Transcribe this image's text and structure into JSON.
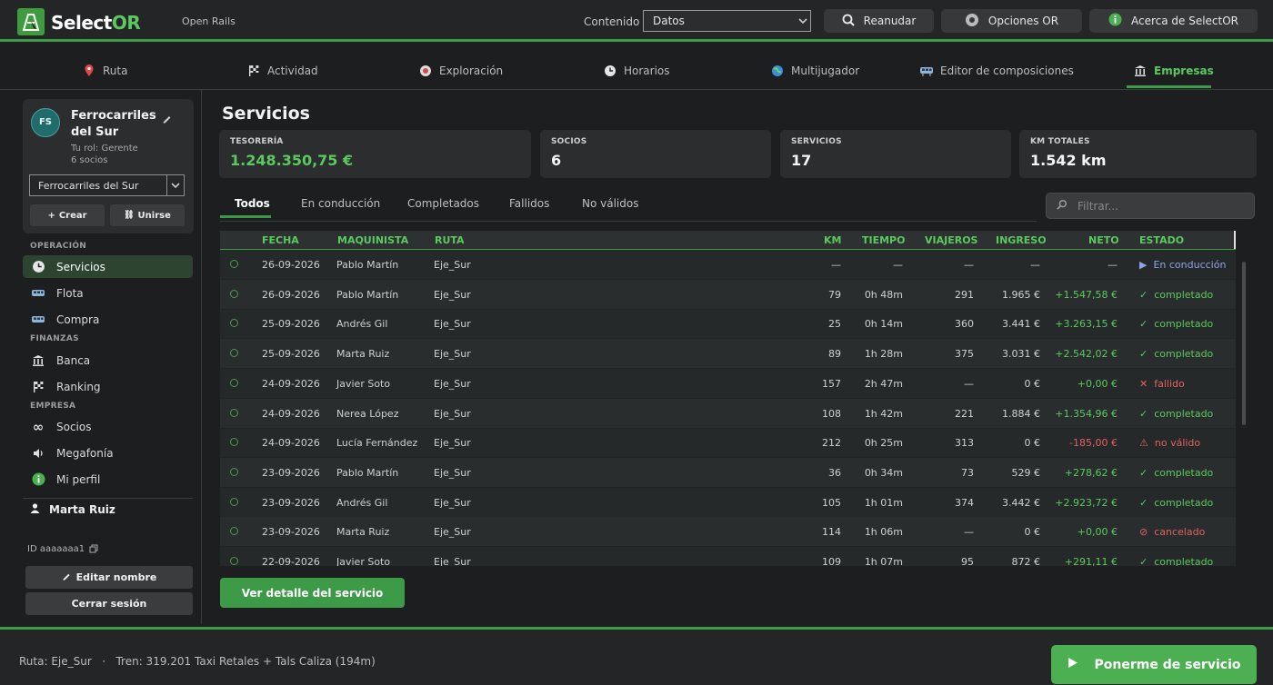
{
  "app": {
    "name_a": "Select",
    "name_b": "OR",
    "subtitle": "Open Rails"
  },
  "topbar": {
    "content_label": "Contenido",
    "content_value": "Datos",
    "resume": "Reanudar",
    "options": "Opciones OR",
    "about": "Acerca de SelectOR"
  },
  "nav": [
    "Ruta",
    "Actividad",
    "Exploración",
    "Horarios",
    "Multijugador",
    "Editor de composiciones",
    "Empresas"
  ],
  "company": {
    "initials": "FS",
    "name": "Ferrocarriles del Sur",
    "role": "Tu rol: Gerente",
    "members": "6 socios",
    "selected": "Ferrocarriles del Sur",
    "create": "Crear",
    "join": "Unirse"
  },
  "sidebar": {
    "sec_operation": "OPERACIÓN",
    "sec_finance": "FINANZAS",
    "sec_company": "EMPRESA",
    "items": [
      "Servicios",
      "Flota",
      "Compra",
      "Banca",
      "Ranking",
      "Socios",
      "Megafonía",
      "Mi perfil"
    ],
    "user": "Marta Ruiz",
    "id": "ID aaaaaaa1",
    "edit_name": "Editar nombre",
    "logout": "Cerrar sesión"
  },
  "main": {
    "title": "Servicios",
    "stats": [
      {
        "label": "TESORERÍA",
        "value": "1.248.350,75 €"
      },
      {
        "label": "SOCIOS",
        "value": "6"
      },
      {
        "label": "SERVICIOS",
        "value": "17"
      },
      {
        "label": "KM TOTALES",
        "value": "1.542 km"
      }
    ],
    "tabs": [
      "Todos",
      "En conducción",
      "Completados",
      "Fallidos",
      "No válidos"
    ],
    "filter_placeholder": "Filtrar...",
    "columns": [
      "FECHA",
      "MAQUINISTA",
      "RUTA",
      "KM",
      "TIEMPO",
      "VIAJEROS",
      "INGRESO",
      "NETO",
      "ESTADO"
    ],
    "rows": [
      {
        "date": "26-09-2026",
        "driver": "Pablo Martín",
        "route": "Eje_Sur",
        "km": "—",
        "time": "—",
        "pax": "—",
        "income": "—",
        "net": "—",
        "status": "En conducción",
        "icon": "▶",
        "kind": "cond"
      },
      {
        "date": "26-09-2026",
        "driver": "Pablo Martín",
        "route": "Eje_Sur",
        "km": "79",
        "time": "0h 48m",
        "pax": "291",
        "income": "1.965 €",
        "net": "+1.547,58 €",
        "status": "completado",
        "icon": "✓",
        "kind": "ok"
      },
      {
        "date": "25-09-2026",
        "driver": "Andrés Gil",
        "route": "Eje_Sur",
        "km": "25",
        "time": "0h 14m",
        "pax": "360",
        "income": "3.441 €",
        "net": "+3.263,15 €",
        "status": "completado",
        "icon": "✓",
        "kind": "ok"
      },
      {
        "date": "25-09-2026",
        "driver": "Marta Ruiz",
        "route": "Eje_Sur",
        "km": "89",
        "time": "1h 28m",
        "pax": "375",
        "income": "3.031 €",
        "net": "+2.542,02 €",
        "status": "completado",
        "icon": "✓",
        "kind": "ok"
      },
      {
        "date": "24-09-2026",
        "driver": "Javier Soto",
        "route": "Eje_Sur",
        "km": "157",
        "time": "2h 47m",
        "pax": "—",
        "income": "0 €",
        "net": "+0,00 €",
        "status": "fallido",
        "icon": "✕",
        "kind": "fail"
      },
      {
        "date": "24-09-2026",
        "driver": "Nerea López",
        "route": "Eje_Sur",
        "km": "108",
        "time": "1h 42m",
        "pax": "221",
        "income": "1.884 €",
        "net": "+1.354,96 €",
        "status": "completado",
        "icon": "✓",
        "kind": "ok"
      },
      {
        "date": "24-09-2026",
        "driver": "Lucía Fernández",
        "route": "Eje_Sur",
        "km": "212",
        "time": "0h 25m",
        "pax": "313",
        "income": "0 €",
        "net": "-185,00 €",
        "status": "no válido",
        "icon": "⚠",
        "kind": "fail"
      },
      {
        "date": "23-09-2026",
        "driver": "Pablo Martín",
        "route": "Eje_Sur",
        "km": "36",
        "time": "0h 34m",
        "pax": "73",
        "income": "529 €",
        "net": "+278,62 €",
        "status": "completado",
        "icon": "✓",
        "kind": "ok"
      },
      {
        "date": "23-09-2026",
        "driver": "Andrés Gil",
        "route": "Eje_Sur",
        "km": "105",
        "time": "1h 01m",
        "pax": "374",
        "income": "3.442 €",
        "net": "+2.923,72 €",
        "status": "completado",
        "icon": "✓",
        "kind": "ok"
      },
      {
        "date": "23-09-2026",
        "driver": "Marta Ruiz",
        "route": "Eje_Sur",
        "km": "114",
        "time": "1h 06m",
        "pax": "—",
        "income": "0 €",
        "net": "+0,00 €",
        "status": "cancelado",
        "icon": "⊘",
        "kind": "fail"
      },
      {
        "date": "22-09-2026",
        "driver": "Javier Soto",
        "route": "Eje_Sur",
        "km": "109",
        "time": "1h 07m",
        "pax": "95",
        "income": "872 €",
        "net": "+291,11 €",
        "status": "completado",
        "icon": "✓",
        "kind": "ok"
      }
    ],
    "detail_button": "Ver detalle del servicio"
  },
  "bottom": {
    "info": "Ruta: Eje_Sur   ·   Tren: 319.201 Taxi Retales + Tals Caliza (194m)",
    "go": "Ponerme de servicio"
  }
}
